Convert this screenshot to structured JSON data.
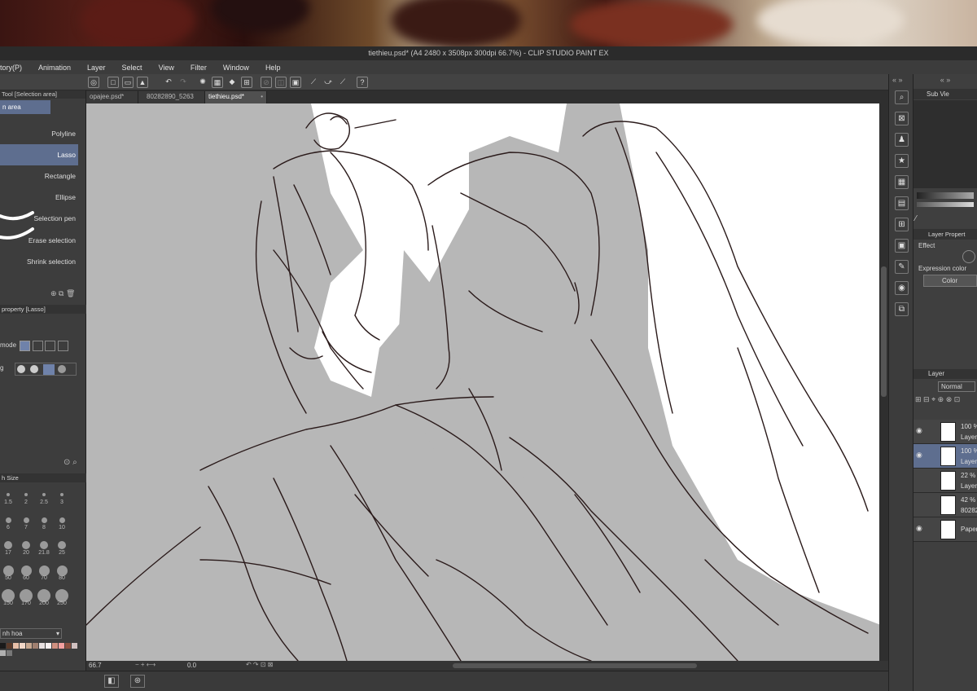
{
  "window": {
    "title": "tiethieu.psd* (A4 2480 x 3508px 300dpi 66.7%)  - CLIP STUDIO PAINT EX"
  },
  "menu": [
    "tory(P)",
    "Animation",
    "Layer",
    "Select",
    "View",
    "Filter",
    "Window",
    "Help"
  ],
  "tabs": [
    {
      "label": "opajee.psd*"
    },
    {
      "label": "80282890_5263"
    },
    {
      "label": "tiethieu.psd*"
    }
  ],
  "tool_panel": {
    "header": "Tool [Selection area]",
    "subtool_tab": "n area",
    "items": [
      "Polyline",
      "Lasso",
      "Rectangle",
      "Ellipse",
      "Selection pen",
      "Erase selection",
      "Shrink selection"
    ],
    "selected": "Lasso"
  },
  "tool_property": {
    "header": "property [Lasso]",
    "mode_label": "mode",
    "aa_label": "g"
  },
  "brush_size": {
    "header": "h Size",
    "values": [
      "1.5",
      "2",
      "2.5",
      "3",
      "6",
      "7",
      "8",
      "10",
      "17",
      "20",
      "21.8",
      "25",
      "50",
      "60",
      "70",
      "80",
      "150",
      "170",
      "200",
      "250"
    ]
  },
  "color_set": {
    "name": "nh hoa",
    "colors": [
      "#1a1a1a",
      "#5a3a2a",
      "#e8c0a8",
      "#f2d8c8",
      "#c8a890",
      "#a08070",
      "#e8e0e0",
      "#f8f0f0",
      "#d09080",
      "#f4a0a0",
      "#8a5040",
      "#d0c0c0",
      "#b0b0b0",
      "#787878"
    ]
  },
  "status": {
    "zoom": "66.7",
    "rotation": "0.0"
  },
  "right_panel": {
    "sub_view": "Sub Vie",
    "layer_property": "Layer Propert",
    "effect_label": "Effect",
    "expression_color_label": "Expression color",
    "color_button": "Color",
    "layer_tab": "Layer",
    "blend_mode": "Normal"
  },
  "layers": [
    {
      "opacity": "100 %",
      "name": "Layer",
      "visible": true,
      "selected": false
    },
    {
      "opacity": "100 %",
      "name": "Layer",
      "visible": true,
      "selected": true
    },
    {
      "opacity": "22 % N",
      "name": "Layer",
      "visible": false,
      "selected": false
    },
    {
      "opacity": "42 % N",
      "name": "802828",
      "visible": false,
      "selected": false
    },
    {
      "opacity": "",
      "name": "Paper",
      "visible": true,
      "selected": false
    }
  ],
  "colors": {
    "selection_accent": "#5e6e8f",
    "canvas_fill": "#b7b7b7",
    "line_art": "#2a1a1a"
  }
}
